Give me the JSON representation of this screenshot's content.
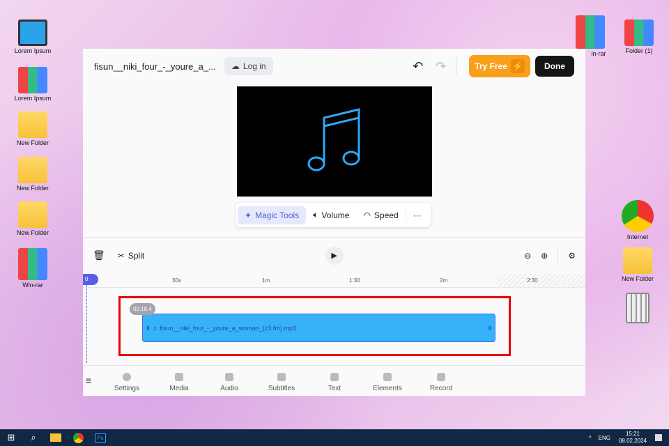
{
  "desktop": {
    "left": [
      "Lorem Ipsum",
      "Lorem Ipsum",
      "New Folder",
      "New Folder",
      "New Folder",
      "Win-rar"
    ],
    "right": [
      "in-rar",
      "Folder (1)",
      "Internet",
      "New Folder"
    ]
  },
  "editor": {
    "filename": "fisun__niki_four_-_youre_a_...",
    "login": "Log in",
    "try_free": "Try Free",
    "done": "Done",
    "tools": [
      "Magic Tools",
      "Volume",
      "Speed",
      "···"
    ],
    "split": "Split",
    "ruler": [
      "0",
      "30s",
      "1m",
      "1:30",
      "2m",
      "2:30"
    ],
    "clip": {
      "time": "00:18.4",
      "name": "fisun__niki_four_-_youre_a_woman_(z3.fm).mp3"
    },
    "bottom_tabs": [
      "Settings",
      "Media",
      "Audio",
      "Subtitles",
      "Text",
      "Elements",
      "Record"
    ]
  },
  "taskbar": {
    "lang": "ENG",
    "time": "15:21",
    "date": "08.02.2024",
    "ps": "Ps"
  }
}
